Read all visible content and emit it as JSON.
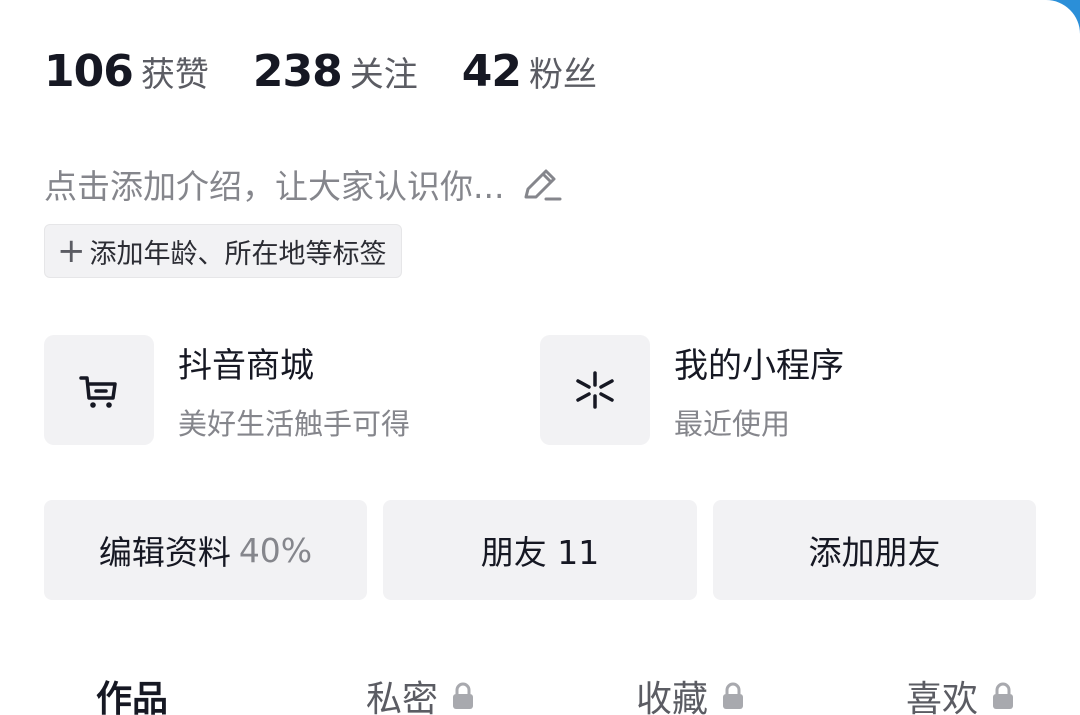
{
  "stats": [
    {
      "value": "106",
      "label": "获赞"
    },
    {
      "value": "238",
      "label": "关注"
    },
    {
      "value": "42",
      "label": "粉丝"
    }
  ],
  "bio": {
    "placeholder": "点击添加介绍，让大家认识你..."
  },
  "tag_chip": {
    "plus": "+",
    "label": "添加年龄、所在地等标签"
  },
  "services": [
    {
      "title": "抖音商城",
      "subtitle": "美好生活触手可得",
      "icon": "shopping-cart-icon"
    },
    {
      "title": "我的小程序",
      "subtitle": "最近使用",
      "icon": "mini-program-icon"
    }
  ],
  "buttons": {
    "edit_profile": {
      "label": "编辑资料",
      "percent": "40%"
    },
    "friends": {
      "label": "朋友 11"
    },
    "add_friend": {
      "label": "添加朋友"
    }
  },
  "tabs": [
    {
      "label": "作品",
      "active": true,
      "locked": false
    },
    {
      "label": "私密",
      "active": false,
      "locked": true
    },
    {
      "label": "收藏",
      "active": false,
      "locked": true
    },
    {
      "label": "喜欢",
      "active": false,
      "locked": true
    }
  ],
  "colors": {
    "primary_text": "#161823",
    "secondary_text": "#85868c",
    "chip_bg": "#f2f2f4",
    "top_bg": "#2b8fd8"
  }
}
